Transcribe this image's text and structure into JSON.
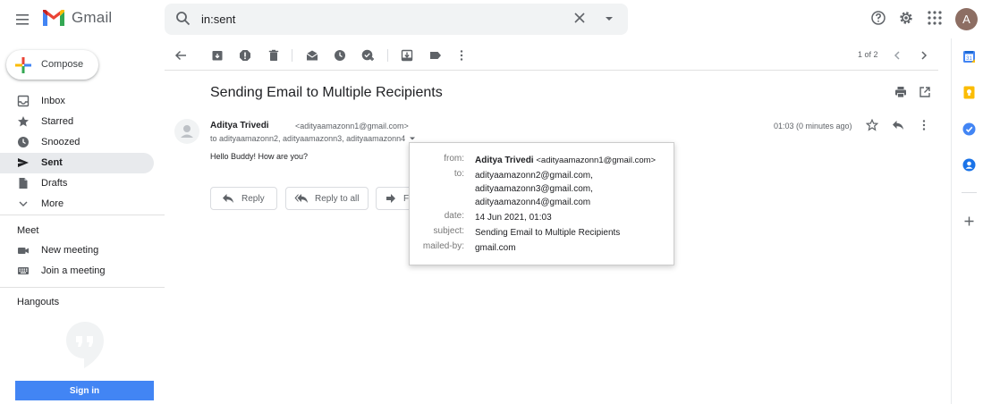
{
  "header": {
    "app_name": "Gmail",
    "search_query": "in:sent",
    "profile_initial": "A"
  },
  "sidebar": {
    "compose_label": "Compose",
    "items": [
      {
        "label": "Inbox",
        "icon": "inbox-icon"
      },
      {
        "label": "Starred",
        "icon": "star-icon"
      },
      {
        "label": "Snoozed",
        "icon": "clock-icon"
      },
      {
        "label": "Sent",
        "icon": "send-icon",
        "active": true
      },
      {
        "label": "Drafts",
        "icon": "draft-icon"
      },
      {
        "label": "More",
        "icon": "chevron-down-icon"
      }
    ],
    "meet": {
      "title": "Meet",
      "items": [
        {
          "label": "New meeting",
          "icon": "video-icon"
        },
        {
          "label": "Join a meeting",
          "icon": "keyboard-icon"
        }
      ]
    },
    "hangouts": {
      "title": "Hangouts",
      "signin_label": "Sign in"
    }
  },
  "toolbar": {
    "pager": "1 of 2"
  },
  "message": {
    "subject": "Sending Email to Multiple Recipients",
    "sender_name": "Aditya Trivedi",
    "sender_email": "<adityaamazonn1@gmail.com>",
    "recipients_line": "to adityaamazonn2, adityaamazonn3, adityaamazonn4",
    "time": "01:03 (0 minutes ago)",
    "body": "Hello Buddy! How are you?",
    "reply_label": "Reply",
    "reply_all_label": "Reply to all",
    "forward_label": "Fo"
  },
  "details": {
    "from_key": "from:",
    "from_name": "Aditya Trivedi",
    "from_email": "<adityaamazonn1@gmail.com>",
    "to_key": "to:",
    "to_values": [
      "adityaamazonn2@gmail.com,",
      "adityaamazonn3@gmail.com,",
      "adityaamazonn4@gmail.com"
    ],
    "date_key": "date:",
    "date_value": "14 Jun 2021, 01:03",
    "subject_key": "subject:",
    "subject_value": "Sending Email to Multiple Recipients",
    "mailedby_key": "mailed-by:",
    "mailedby_value": "gmail.com"
  },
  "colors": {
    "accent_blue": "#4285f4",
    "active_nav_bg": "#e8eaed",
    "icon_gray": "#5f6368"
  }
}
